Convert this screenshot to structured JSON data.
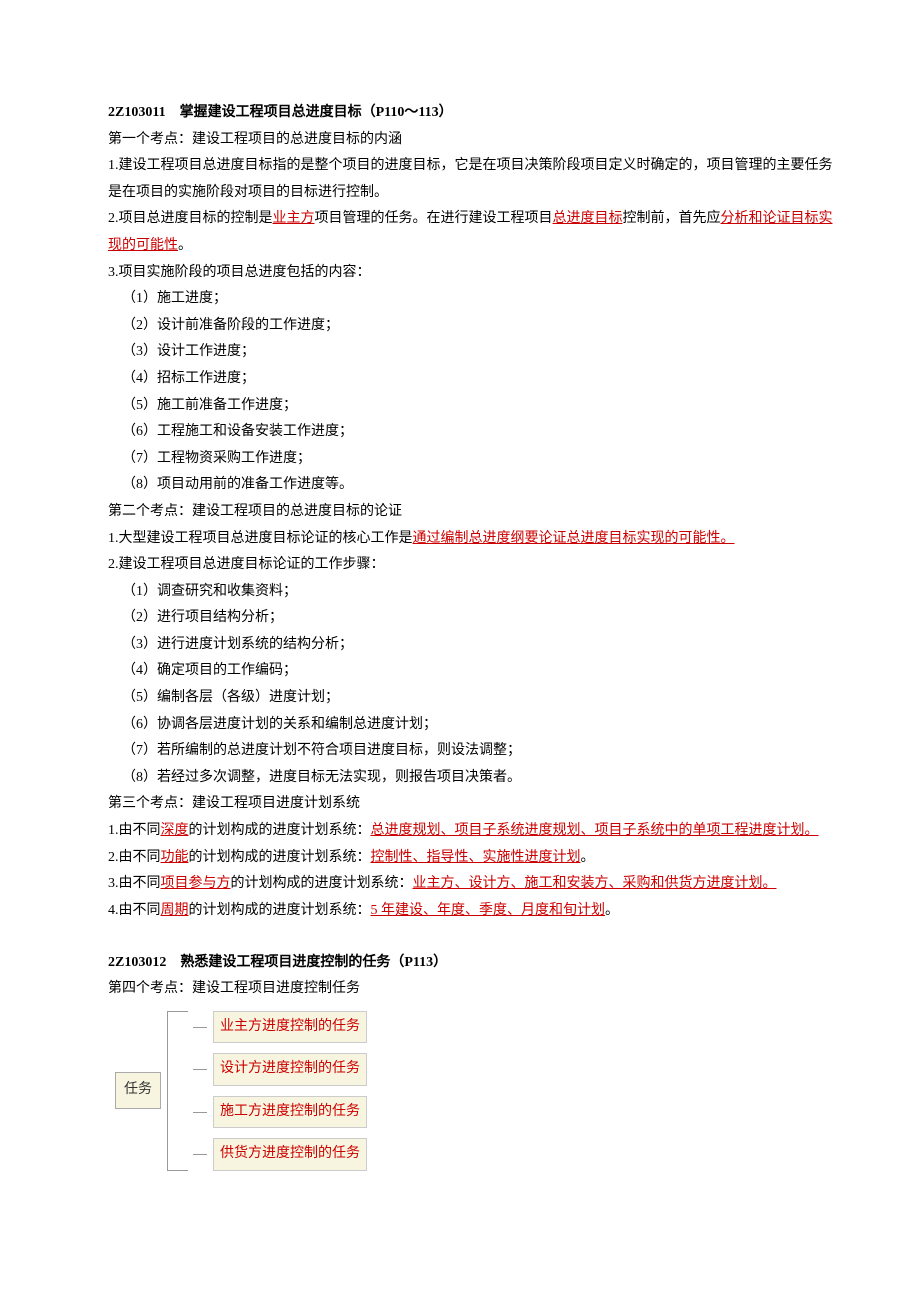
{
  "section1": {
    "title": "2Z103011　掌握建设工程项目总进度目标（P110～113）",
    "kp1": {
      "heading": "第一个考点：建设工程项目的总进度目标的内涵",
      "p1": "1.建设工程项目总进度目标指的是整个项目的进度目标，它是在项目决策阶段项目定义时确定的，项目管理的主要任务是在项目的实施阶段对项目的目标进行控制。",
      "p2_a": "2.项目总进度目标的控制是",
      "p2_h1": "业主方",
      "p2_b": "项目管理的任务。在进行建设工程项目",
      "p2_h2": "总进度目标",
      "p2_c": "控制前，首先应",
      "p2_h3": "分析和论证目标实现的可能性",
      "p2_d": "。",
      "p3": "3.项目实施阶段的项目总进度包括的内容：",
      "list": [
        "（1）施工进度；",
        "（2）设计前准备阶段的工作进度；",
        "（3）设计工作进度；",
        "（4）招标工作进度；",
        "（5）施工前准备工作进度；",
        "（6）工程施工和设备安装工作进度；",
        "（7）工程物资采购工作进度；",
        "（8）项目动用前的准备工作进度等。"
      ]
    },
    "kp2": {
      "heading": "第二个考点：建设工程项目的总进度目标的论证",
      "p1_a": "1.大型建设工程项目总进度目标论证的核心工作是",
      "p1_h": "通过编制总进度纲要论证总进度目标实现的可能性。",
      "p2": "2.建设工程项目总进度目标论证的工作步骤：",
      "list": [
        "（1）调查研究和收集资料；",
        "（2）进行项目结构分析；",
        "（3）进行进度计划系统的结构分析；",
        "（4）确定项目的工作编码；",
        "（5）编制各层（各级）进度计划；",
        "（6）协调各层进度计划的关系和编制总进度计划；",
        "（7）若所编制的总进度计划不符合项目进度目标，则设法调整；",
        "（8）若经过多次调整，进度目标无法实现，则报告项目决策者。"
      ]
    },
    "kp3": {
      "heading": "第三个考点：建设工程项目进度计划系统",
      "p1_a": "1.由不同",
      "p1_h1": "深度",
      "p1_b": "的计划构成的进度计划系统：",
      "p1_h2": "总进度规划、项目子系统进度规划、项目子系统中的单项工程进度计划。",
      "p2_a": "2.由不同",
      "p2_h1": "功能",
      "p2_b": "的计划构成的进度计划系统：",
      "p2_h2": "控制性、指导性、实施性进度计划",
      "p2_c": "。",
      "p3_a": "3.由不同",
      "p3_h1": "项目参与方",
      "p3_b": "的计划构成的进度计划系统：",
      "p3_h2": "业主方、设计方、施工和安装方、采购和供货方进度计划。",
      "p4_a": "4.由不同",
      "p4_h1": "周期",
      "p4_b": "的计划构成的进度计划系统：",
      "p4_h2": "5 年建设、年度、季度、月度和旬计划",
      "p4_c": "。"
    }
  },
  "section2": {
    "title": "2Z103012　熟悉建设工程项目进度控制的任务（P113）",
    "kp4": {
      "heading": "第四个考点：建设工程项目进度控制任务",
      "root": "任务",
      "branches": [
        "业主方进度控制的任务",
        "设计方进度控制的任务",
        "施工方进度控制的任务",
        "供货方进度控制的任务"
      ]
    }
  }
}
